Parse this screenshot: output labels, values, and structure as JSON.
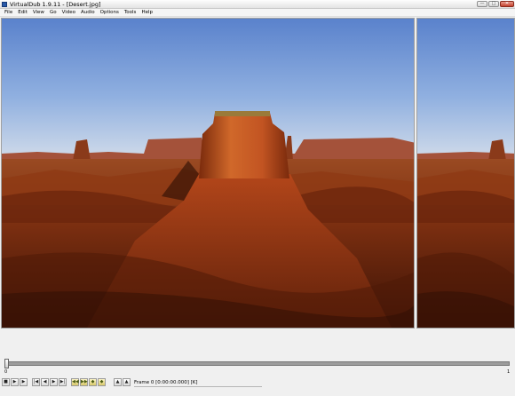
{
  "window": {
    "title": "VirtualDub 1.9.11 - [Desert.jpg]",
    "icon": "virtualdub-app-icon",
    "controls": {
      "minimize": "—",
      "maximize": "□",
      "close": "✕"
    }
  },
  "menu": {
    "items": [
      "File",
      "Edit",
      "View",
      "Go",
      "Video",
      "Audio",
      "Options",
      "Tools",
      "Help"
    ]
  },
  "panes": {
    "input": {
      "content": "desert-landscape-image"
    },
    "output": {
      "content": "desert-landscape-image"
    }
  },
  "timeline": {
    "position_fraction": 0,
    "start_label": "0",
    "end_label": "1"
  },
  "toolbar": {
    "buttons": [
      {
        "name": "stop-button",
        "glyph": "■"
      },
      {
        "name": "play-input-button",
        "glyph": "▶"
      },
      {
        "name": "play-output-button",
        "glyph": "▶"
      },
      {
        "name": "go-start-button",
        "glyph": "|◀"
      },
      {
        "name": "prev-frame-button",
        "glyph": "◀"
      },
      {
        "name": "next-frame-button",
        "glyph": "▶"
      },
      {
        "name": "go-end-button",
        "glyph": "▶|"
      },
      {
        "name": "prev-key-button",
        "glyph": "◀◀"
      },
      {
        "name": "next-key-button",
        "glyph": "▶▶"
      },
      {
        "name": "scene-back-button",
        "glyph": "◆"
      },
      {
        "name": "scene-forward-button",
        "glyph": "◆"
      },
      {
        "name": "mark-in-button",
        "glyph": "▲"
      },
      {
        "name": "mark-out-button",
        "glyph": "▲"
      }
    ],
    "frame_label": "Frame 0 [0:00:00.000] [K]"
  },
  "colors": {
    "sky_top": "#5f86cf",
    "sky_bottom": "#c8d8ee",
    "rock": "#c0561f",
    "ground": "#6e2a0f"
  }
}
